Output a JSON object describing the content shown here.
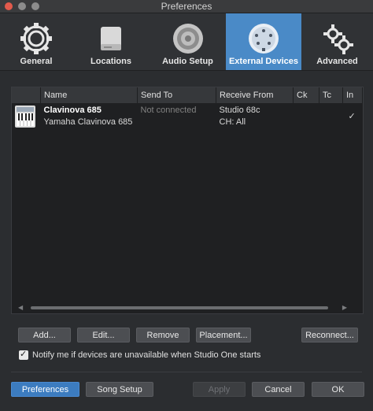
{
  "window": {
    "title": "Preferences"
  },
  "tabs": [
    {
      "label": "General",
      "icon": "gear-icon",
      "active": false
    },
    {
      "label": "Locations",
      "icon": "drive-icon",
      "active": false
    },
    {
      "label": "Audio Setup",
      "icon": "speaker-icon",
      "active": false
    },
    {
      "label": "External Devices",
      "icon": "midi-connector-icon",
      "active": true
    },
    {
      "label": "Advanced",
      "icon": "gears-icon",
      "active": false
    }
  ],
  "table": {
    "columns": [
      "Name",
      "Send To",
      "Receive From",
      "Ck",
      "Tc",
      "In"
    ],
    "rows": [
      {
        "name": "Clavinova 685",
        "model": "Yamaha Clavinova 685",
        "send_to": "Not connected",
        "receive_from": "Studio 68c",
        "channel": "CH: All",
        "ck": "",
        "tc": "",
        "in": "✓",
        "icon": "keyboard-icon"
      }
    ]
  },
  "device_buttons": {
    "add": "Add...",
    "edit": "Edit...",
    "remove": "Remove",
    "placement": "Placement...",
    "reconnect": "Reconnect..."
  },
  "notify": {
    "checked": true,
    "label": "Notify me if devices are unavailable when Studio One starts"
  },
  "footer": {
    "preferences": "Preferences",
    "song_setup": "Song Setup",
    "apply": "Apply",
    "cancel": "Cancel",
    "ok": "OK"
  },
  "colors": {
    "accent": "#4a8ac7",
    "background": "#2b2d30",
    "panel": "#1f2022"
  }
}
